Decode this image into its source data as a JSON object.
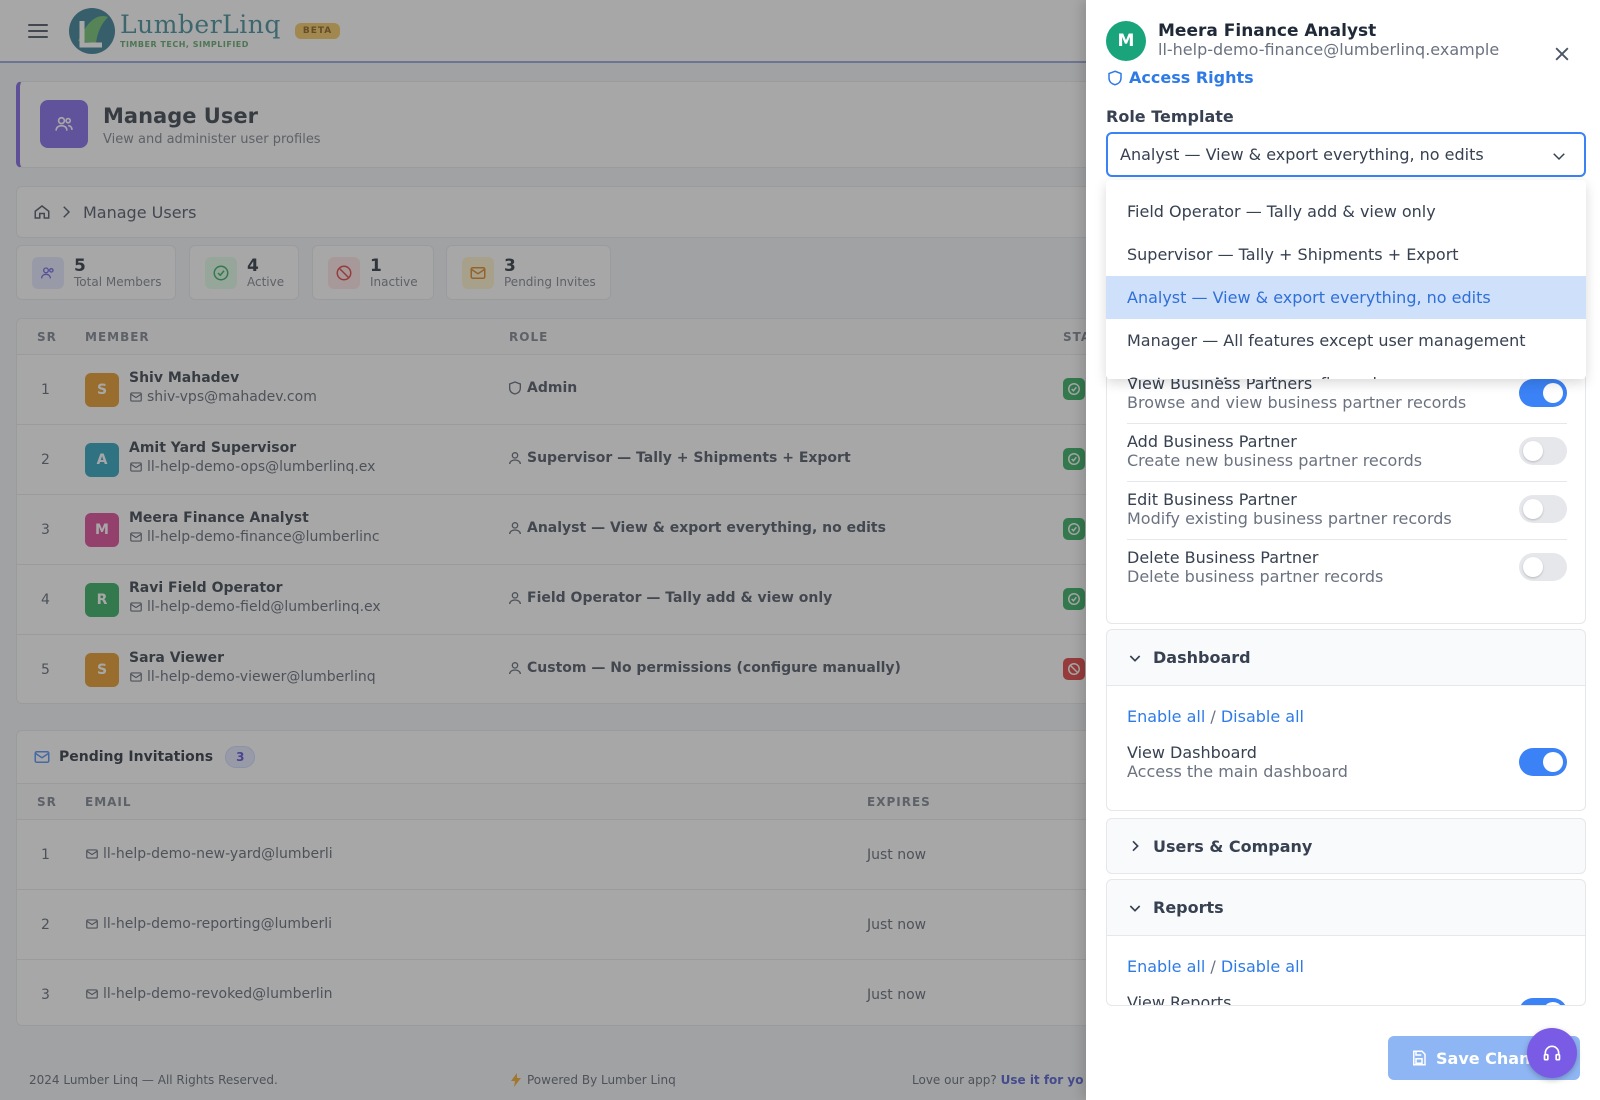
{
  "brand": {
    "name": "LumberLinq",
    "tagline": "TIMBER TECH, SIMPLIFIED",
    "badge": "BETA"
  },
  "page": {
    "title": "Manage User",
    "subtitle": "View and administer user profiles",
    "breadcrumb": "Manage Users"
  },
  "stats": [
    {
      "value": "5",
      "label": "Total Members"
    },
    {
      "value": "4",
      "label": "Active"
    },
    {
      "value": "1",
      "label": "Inactive"
    },
    {
      "value": "3",
      "label": "Pending Invites"
    }
  ],
  "users_table": {
    "headers": {
      "sr": "SR",
      "member": "MEMBER",
      "role": "ROLE",
      "status": "STA"
    },
    "rows": [
      {
        "sr": "1",
        "initial": "S",
        "name": "Shiv Mahadev",
        "email": "shiv-vps@mahadev.com",
        "role": "Admin",
        "avatar_color": "#e08a0b",
        "status_color": "#16a34a"
      },
      {
        "sr": "2",
        "initial": "A",
        "name": "Amit Yard Supervisor",
        "email": "ll-help-demo-ops@lumberlinq.ex",
        "role": "Supervisor — Tally + Shipments + Export",
        "avatar_color": "#0e97b5",
        "status_color": "#16a34a"
      },
      {
        "sr": "3",
        "initial": "M",
        "name": "Meera Finance Analyst",
        "email": "ll-help-demo-finance@lumberlinc",
        "role": "Analyst — View & export everything, no edits",
        "avatar_color": "#d6308a",
        "status_color": "#16a34a"
      },
      {
        "sr": "4",
        "initial": "R",
        "name": "Ravi Field Operator",
        "email": "ll-help-demo-field@lumberlinq.ex",
        "role": "Field Operator — Tally add & view only",
        "avatar_color": "#16a34a",
        "status_color": "#16a34a"
      },
      {
        "sr": "5",
        "initial": "S",
        "name": "Sara Viewer",
        "email": "ll-help-demo-viewer@lumberlinq",
        "role": "Custom — No permissions (configure manually)",
        "avatar_color": "#e08a0b",
        "status_color": "#dc2626"
      }
    ]
  },
  "invitations": {
    "title": "Pending Invitations",
    "count": "3",
    "headers": {
      "sr": "SR",
      "email": "EMAIL",
      "expires": "EXPIRES"
    },
    "rows": [
      {
        "sr": "1",
        "email": "ll-help-demo-new-yard@lumberli",
        "expires": "Just now"
      },
      {
        "sr": "2",
        "email": "ll-help-demo-reporting@lumberli",
        "expires": "Just now"
      },
      {
        "sr": "3",
        "email": "ll-help-demo-revoked@lumberlin",
        "expires": "Just now"
      }
    ]
  },
  "footer": {
    "copyright": "2024 Lumber Linq — All Rights Reserved.",
    "powered": "Powered By Lumber Linq",
    "love": "Love our app?",
    "cta": "Use it for yo"
  },
  "drawer": {
    "initial": "M",
    "name": "Meera Finance Analyst",
    "email": "ll-help-demo-finance@lumberlinq.example",
    "access_label": "Access Rights",
    "role_template_label": "Role Template",
    "selected_role": "Analyst — View & export everything, no edits",
    "role_options": [
      "Field Operator — Tally add & view only",
      "Supervisor — Tally + Shipments + Export",
      "Analyst — View & export everything, no edits",
      "Manager — All features except user management",
      "Custom — Manually configured"
    ],
    "partner_permissions": [
      {
        "title": "View Business Partners",
        "desc": "Browse and view business partner records",
        "enabled": true
      },
      {
        "title": "Add Business Partner",
        "desc": "Create new business partner records",
        "enabled": false
      },
      {
        "title": "Edit Business Partner",
        "desc": "Modify existing business partner records",
        "enabled": false
      },
      {
        "title": "Delete Business Partner",
        "desc": "Delete business partner records",
        "enabled": false
      }
    ],
    "sections": {
      "dashboard": {
        "title": "Dashboard",
        "enable_all": "Enable all",
        "sep": "/",
        "disable_all": "Disable all",
        "perm_title": "View Dashboard",
        "perm_desc": "Access the main dashboard",
        "enabled": true
      },
      "users_company": {
        "title": "Users & Company"
      },
      "reports": {
        "title": "Reports",
        "enable_all": "Enable all",
        "sep": "/",
        "disable_all": "Disable all",
        "perm_title": "View Reports",
        "enabled": true
      }
    },
    "save_label": "Save Chang"
  }
}
